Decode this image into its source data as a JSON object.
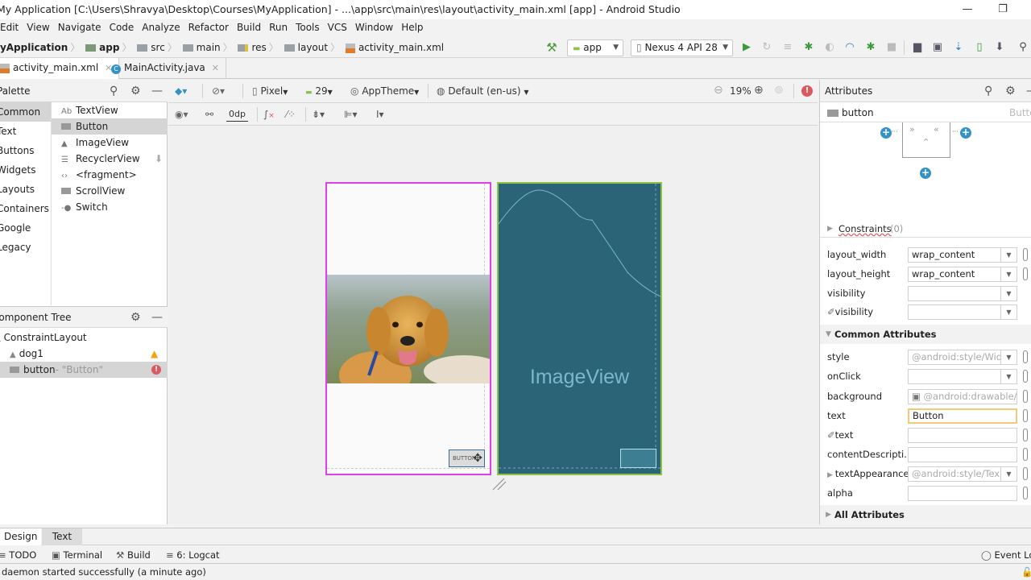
{
  "window": {
    "title": "My Application [C:\\Users\\Shravya\\Desktop\\Courses\\MyApplication] - ...\\app\\src\\main\\res\\layout\\activity_main.xml [app] - Android Studio",
    "minimize": "—",
    "restore": "❐"
  },
  "menu": [
    "Edit",
    "View",
    "Navigate",
    "Code",
    "Analyze",
    "Refactor",
    "Build",
    "Run",
    "Tools",
    "VCS",
    "Window",
    "Help"
  ],
  "breadcrumb": [
    "MyApplication",
    "app",
    "src",
    "main",
    "res",
    "layout",
    "activity_main.xml"
  ],
  "run_toolbar": {
    "config": "app",
    "device": "Nexus 4 API 28"
  },
  "editor_tabs": [
    {
      "label": "activity_main.xml",
      "active": true
    },
    {
      "label": "MainActivity.java",
      "active": false
    }
  ],
  "palette": {
    "title": "Palette",
    "categories": [
      "Common",
      "Text",
      "Buttons",
      "Widgets",
      "Layouts",
      "Containers",
      "Google",
      "Legacy"
    ],
    "selected_category": "Common",
    "items": [
      {
        "label": "TextView",
        "icon": "Ab"
      },
      {
        "label": "Button",
        "icon": "button-icon"
      },
      {
        "label": "ImageView",
        "icon": "image-icon"
      },
      {
        "label": "RecyclerView",
        "icon": "list-icon"
      },
      {
        "label": "<fragment>",
        "icon": "code-icon"
      },
      {
        "label": "ScrollView",
        "icon": "scrollview-icon"
      },
      {
        "label": "Switch",
        "icon": "switch-icon"
      }
    ],
    "selected_item": "Button"
  },
  "component_tree": {
    "title": "Component Tree",
    "root": "ConstraintLayout",
    "children": [
      {
        "label": "dog1",
        "status": "warning"
      },
      {
        "label": "button",
        "detail": "- \"Button\"",
        "status": "error"
      }
    ]
  },
  "design_toolbar": {
    "device": "Pixel",
    "api": "29",
    "theme": "AppTheme",
    "locale": "Default (en-us)",
    "zoom": "19%",
    "margin": "0dp"
  },
  "blueprint": {
    "placeholder": "ImageView"
  },
  "attributes": {
    "title": "Attributes",
    "component": "button",
    "component_type": "Button",
    "constraints_label": "Constraints",
    "constraints_count": "(0)",
    "layout_rows": [
      {
        "label": "layout_width",
        "value": "wrap_content",
        "dropdown": true,
        "pin": true
      },
      {
        "label": "layout_height",
        "value": "wrap_content",
        "dropdown": true,
        "pin": true
      },
      {
        "label": "visibility",
        "value": "",
        "dropdown": true,
        "pin": false
      },
      {
        "label": "visibility",
        "value": "",
        "dropdown": true,
        "pin": false,
        "tool": true
      }
    ],
    "common_section": "Common Attributes",
    "common_rows": [
      {
        "label": "style",
        "value": "@android:style/Wid",
        "dropdown": true,
        "hint": true
      },
      {
        "label": "onClick",
        "value": "",
        "dropdown": true
      },
      {
        "label": "background",
        "value": "@android:drawable/b",
        "dropdown": false,
        "hint": true
      },
      {
        "label": "text",
        "value": "Button",
        "dropdown": false,
        "focused": true
      },
      {
        "label": "text",
        "value": "",
        "dropdown": false,
        "tool": true
      },
      {
        "label": "contentDescripti...",
        "value": "",
        "dropdown": false
      },
      {
        "label": "textAppearance",
        "value": "@android:style/Tex",
        "dropdown": true,
        "hint": true,
        "expandable": true
      },
      {
        "label": "alpha",
        "value": "",
        "dropdown": false
      }
    ],
    "all_section": "All Attributes"
  },
  "bottom_tabs": [
    "Design",
    "Text"
  ],
  "tool_windows": [
    "TODO",
    "Terminal",
    "Build",
    "6: Logcat"
  ],
  "event_log": "Event Log",
  "status": "daemon started successfully (a minute ago)",
  "colors": {
    "accent_blue": "#3592c4",
    "design_border": "#e040e8",
    "blueprint_bg": "#2b6377",
    "blueprint_border": "#8bc34a",
    "error": "#db5860",
    "warning": "#f0a30a"
  }
}
